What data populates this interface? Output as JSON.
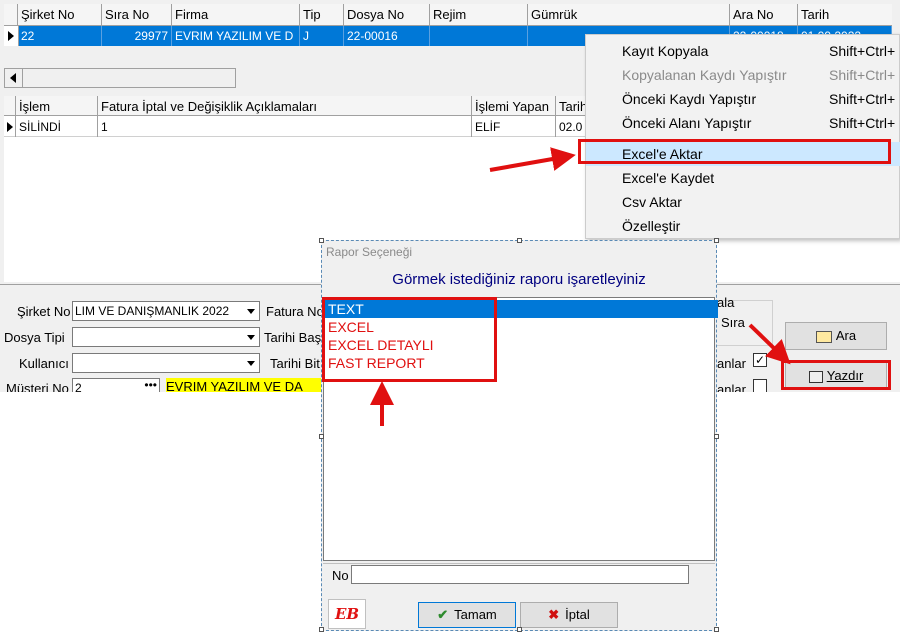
{
  "grid": {
    "columns": [
      "Şirket No",
      "Sıra No",
      "Firma",
      "Tip",
      "Dosya No",
      "Rejim",
      "Gümrük",
      "Ara No",
      "Tarih"
    ],
    "row": {
      "sirket_no": "22",
      "sira_no": "29977",
      "firma": "EVRIM YAZILIM VE D",
      "tip": "J",
      "dosya_no": "22-00016",
      "rejim": "",
      "gumruk": "",
      "ara_no": "22-00018",
      "tarih": "01.09.2022"
    }
  },
  "detail_grid": {
    "columns": [
      "İşlem",
      "Fatura İptal ve Değişiklik Açıklamaları",
      "İşlemi Yapan",
      "Tarih"
    ],
    "row": {
      "islem": "SİLİNDİ",
      "aciklama": "1",
      "yapan": "ELİF",
      "tarih": "02.0"
    }
  },
  "context_menu": {
    "items": [
      {
        "label": "Kayıt Kopyala",
        "shortcut": "Shift+Ctrl+",
        "disabled": false
      },
      {
        "label": "Kopyalanan Kaydı Yapıştır",
        "shortcut": "Shift+Ctrl+",
        "disabled": true
      },
      {
        "label": "Önceki Kaydı Yapıştır",
        "shortcut": "Shift+Ctrl+",
        "disabled": false
      },
      {
        "label": "Önceki Alanı Yapıştır",
        "shortcut": "Shift+Ctrl+",
        "disabled": false
      },
      {
        "label": "Excel'e Aktar",
        "shortcut": "",
        "highlighted": true
      },
      {
        "label": "Excel'e Kaydet",
        "shortcut": ""
      },
      {
        "label": "Csv Aktar",
        "shortcut": ""
      },
      {
        "label": "Özelleştir",
        "shortcut": ""
      }
    ]
  },
  "filters": {
    "sirket_no_label": "Şirket No",
    "sirket_no_value": "LIM  VE DANIŞMANLIK 2022",
    "fatura_no_label": "Fatura No",
    "dosya_tipi_label": "Dosya Tipi",
    "tarihi_bas_label": "Tarihi Baş",
    "kullanici_label": "Kullanıcı",
    "tarihi_bit_label": "Tarihi Bit",
    "musteri_no_label": "Müşteri No",
    "musteri_no_value": "2",
    "musteri_name": "EVRIM YAZILIM VE DA",
    "group_frag": "ala",
    "sira_frag": "Sıra",
    "check1_frag": "anlar",
    "check2_frag": "anlar",
    "ara_label": "Ara",
    "yazdir_label": "Yazdır"
  },
  "dialog": {
    "title": "Rapor Seçeneği",
    "heading": "Görmek istediğiniz raporu işaretleyiniz",
    "options": [
      "TEXT",
      "EXCEL",
      "EXCEL DETAYLI",
      "FAST REPORT"
    ],
    "selected_index": 0,
    "no_label": "No",
    "no_value": "",
    "logo_text": "EB",
    "ok_label": "Tamam",
    "cancel_label": "İptal"
  },
  "colors": {
    "selection": "#0078d7",
    "annotation_red": "#e01010",
    "menu_highlight": "#cce8ff",
    "heading_blue": "#000080"
  }
}
